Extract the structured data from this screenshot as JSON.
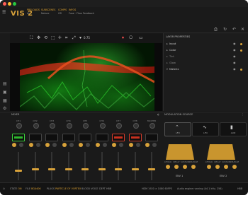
{
  "header": {
    "logo": "VIS 2",
    "fields": [
      {
        "key": "PRELOADS",
        "value": "Air"
      },
      {
        "key": "SUBSCENES",
        "value": "Nature"
      },
      {
        "key": "COMPS",
        "value": "Gfl"
      },
      {
        "key": "INFOS",
        "value": "Fuse · Flow Feedback"
      }
    ],
    "right_icons": [
      "print-icon",
      "camera-icon",
      "refresh-icon",
      "close-icon"
    ]
  },
  "toolbar": {
    "zoom": "0.75"
  },
  "layers_panel": {
    "title": "LAYER PROPERTIES",
    "rows": [
      {
        "label": "Input",
        "selected": true
      },
      {
        "label": "Color",
        "selected": true
      },
      {
        "label": "Tint",
        "selected": false
      },
      {
        "label": "Glow",
        "selected": false
      },
      {
        "label": "Materix",
        "selected": true
      }
    ]
  },
  "mixer": {
    "title": "MIXER",
    "channels": [
      {
        "label": "CH1",
        "active": true,
        "fader": 0.35
      },
      {
        "label": "CH2",
        "active": false,
        "fader": 0.4
      },
      {
        "label": "CH3",
        "active": false,
        "fader": 0.4
      },
      {
        "label": "CH4",
        "active": false,
        "fader": 0.4
      },
      {
        "label": "CH5",
        "active": false,
        "fader": 0.4
      },
      {
        "label": "CH6",
        "active": false,
        "fader": 0.4
      },
      {
        "label": "CH7",
        "active": true,
        "fader": 0.4
      },
      {
        "label": "CH8",
        "active": true,
        "fader": 0.4
      },
      {
        "label": "MASTER",
        "active": false,
        "fader": 0.4
      }
    ]
  },
  "modulation": {
    "title": "MODULATION SOURCE",
    "buttons": [
      {
        "label": "LFO",
        "icon": "envelope-icon"
      },
      {
        "label": "LFO",
        "icon": "waveform-icon"
      },
      {
        "label": "AUD",
        "icon": "audio-icon"
      }
    ],
    "knob_labels": [
      "ATTACK",
      "DECAY",
      "SUSTAIN",
      "RELEASE",
      "ATTACK",
      "DECAY",
      "SUSTAIN",
      "RELEASE"
    ],
    "outputs": [
      "ENV 1",
      "ENV 2"
    ]
  },
  "status": {
    "items": [
      {
        "k": "STATE",
        "v": "ON"
      },
      {
        "k": "FILE",
        "v": "BG4406"
      },
      {
        "k": "PLUGS",
        "v": "PARTICLE OF VORTEX"
      },
      {
        "k": "",
        "v": "BLOOD VOICE"
      },
      {
        "k": "",
        "v": "DEPT HBB"
      }
    ],
    "right": "HDM   1920 × 1080   60FPS",
    "engine": "Audio engine running (44.1 kHz, 256)",
    "far_right": "HBB"
  }
}
